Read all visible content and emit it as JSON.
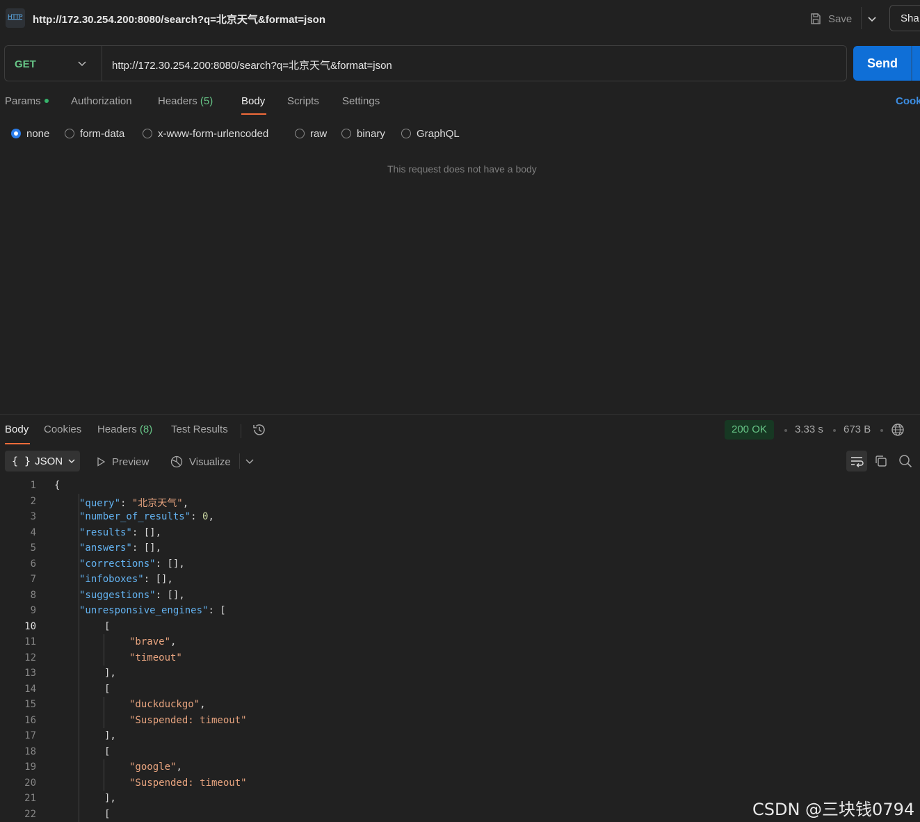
{
  "window": {
    "title": "http://172.30.254.200:8080/search?q=北京天气&format=json",
    "http_icon_label": "HTTP",
    "save_label": "Save",
    "share_label": "Sha"
  },
  "request": {
    "method": "GET",
    "url": "http://172.30.254.200:8080/search?q=北京天气&format=json",
    "send_label": "Send",
    "tabs": [
      {
        "label": "Params",
        "count": ""
      },
      {
        "label": "Authorization",
        "count": ""
      },
      {
        "label": "Headers",
        "count": "(5)"
      },
      {
        "label": "Body",
        "count": ""
      },
      {
        "label": "Scripts",
        "count": ""
      },
      {
        "label": "Settings",
        "count": ""
      }
    ],
    "active_tab": "Body",
    "cookies_label": "Cook",
    "body_types": [
      "none",
      "form-data",
      "x-www-form-urlencoded",
      "raw",
      "binary",
      "GraphQL"
    ],
    "selected_body_type": "none",
    "no_body_message": "This request does not have a body"
  },
  "response": {
    "tabs": [
      {
        "label": "Body",
        "count": ""
      },
      {
        "label": "Cookies",
        "count": ""
      },
      {
        "label": "Headers",
        "count": "(8)"
      },
      {
        "label": "Test Results",
        "count": ""
      }
    ],
    "status": "200 OK",
    "time": "3.33 s",
    "size": "673 B",
    "format_label": "JSON",
    "format_braces": "{ }",
    "preview_label": "Preview",
    "visualize_label": "Visualize",
    "current_line": 10,
    "code_lines": [
      {
        "n": "1",
        "tokens": [
          {
            "t": "p",
            "v": "{"
          }
        ]
      },
      {
        "n": "2",
        "tokens": [
          {
            "t": "k",
            "v": "\"query\""
          },
          {
            "t": "p",
            "v": ": "
          },
          {
            "t": "s",
            "v": "\"北京天气\""
          },
          {
            "t": "p",
            "v": ","
          }
        ]
      },
      {
        "n": "3",
        "tokens": [
          {
            "t": "k",
            "v": "\"number_of_results\""
          },
          {
            "t": "p",
            "v": ": "
          },
          {
            "t": "n",
            "v": "0"
          },
          {
            "t": "p",
            "v": ","
          }
        ]
      },
      {
        "n": "4",
        "tokens": [
          {
            "t": "k",
            "v": "\"results\""
          },
          {
            "t": "p",
            "v": ": [],"
          }
        ]
      },
      {
        "n": "5",
        "tokens": [
          {
            "t": "k",
            "v": "\"answers\""
          },
          {
            "t": "p",
            "v": ": [],"
          }
        ]
      },
      {
        "n": "6",
        "tokens": [
          {
            "t": "k",
            "v": "\"corrections\""
          },
          {
            "t": "p",
            "v": ": [],"
          }
        ]
      },
      {
        "n": "7",
        "tokens": [
          {
            "t": "k",
            "v": "\"infoboxes\""
          },
          {
            "t": "p",
            "v": ": [],"
          }
        ]
      },
      {
        "n": "8",
        "tokens": [
          {
            "t": "k",
            "v": "\"suggestions\""
          },
          {
            "t": "p",
            "v": ": [],"
          }
        ]
      },
      {
        "n": "9",
        "tokens": [
          {
            "t": "k",
            "v": "\"unresponsive_engines\""
          },
          {
            "t": "p",
            "v": ": ["
          }
        ]
      },
      {
        "n": "10",
        "tokens": [
          {
            "t": "p",
            "v": "["
          }
        ]
      },
      {
        "n": "11",
        "tokens": [
          {
            "t": "s",
            "v": "\"brave\""
          },
          {
            "t": "p",
            "v": ","
          }
        ]
      },
      {
        "n": "12",
        "tokens": [
          {
            "t": "s",
            "v": "\"timeout\""
          }
        ]
      },
      {
        "n": "13",
        "tokens": [
          {
            "t": "p",
            "v": "],"
          }
        ]
      },
      {
        "n": "14",
        "tokens": [
          {
            "t": "p",
            "v": "["
          }
        ]
      },
      {
        "n": "15",
        "tokens": [
          {
            "t": "s",
            "v": "\"duckduckgo\""
          },
          {
            "t": "p",
            "v": ","
          }
        ]
      },
      {
        "n": "16",
        "tokens": [
          {
            "t": "s",
            "v": "\"Suspended: timeout\""
          }
        ]
      },
      {
        "n": "17",
        "tokens": [
          {
            "t": "p",
            "v": "],"
          }
        ]
      },
      {
        "n": "18",
        "tokens": [
          {
            "t": "p",
            "v": "["
          }
        ]
      },
      {
        "n": "19",
        "tokens": [
          {
            "t": "s",
            "v": "\"google\""
          },
          {
            "t": "p",
            "v": ","
          }
        ]
      },
      {
        "n": "20",
        "tokens": [
          {
            "t": "s",
            "v": "\"Suspended: timeout\""
          }
        ]
      },
      {
        "n": "21",
        "tokens": [
          {
            "t": "p",
            "v": "],"
          }
        ]
      },
      {
        "n": "22",
        "tokens": [
          {
            "t": "p",
            "v": "["
          }
        ]
      }
    ]
  },
  "watermark": "CSDN @三块钱0794",
  "colors": {
    "accent": "#f26b3a",
    "send": "#0f6fd7",
    "success": "#67c587",
    "json_key": "#63b2f0",
    "json_string": "#e8a47f"
  }
}
